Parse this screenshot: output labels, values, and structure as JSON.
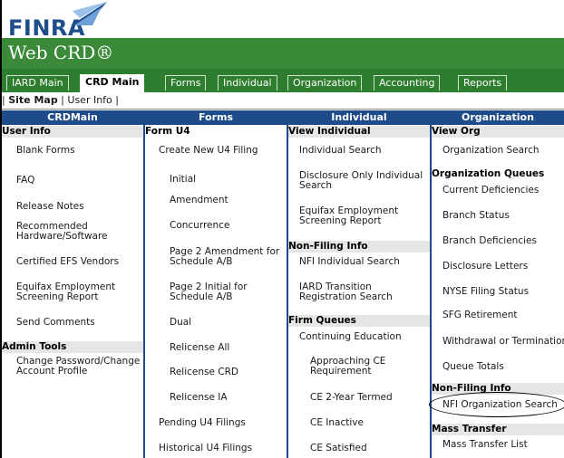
{
  "header": {
    "logo_text": "FINRA",
    "app_title": "Web CRD®"
  },
  "tabs": [
    {
      "label": "IARD Main"
    },
    {
      "label": "CRD Main"
    },
    {
      "label": "Forms"
    },
    {
      "label": "Individual"
    },
    {
      "label": "Organization"
    },
    {
      "label": "Accounting"
    },
    {
      "label": "Reports"
    }
  ],
  "sitemap": {
    "pipe1": "| ",
    "site_map": "Site Map",
    "pipe2": " | ",
    "user_info": "User Info",
    "pipe3": " |"
  },
  "columns": {
    "crdmain": {
      "title": "CRDMain",
      "user_info": "User Info",
      "blank_forms": "Blank Forms",
      "faq": "FAQ",
      "release_notes": "Release Notes",
      "recommended_1": "Recommended",
      "recommended_2": "Hardware/Software",
      "efs_vendors": "Certified EFS Vendors",
      "equifax_1": "Equifax Employment",
      "equifax_2": "Screening Report",
      "send_comments": "Send Comments",
      "admin_tools": "Admin Tools",
      "change_pw_1": "Change Password/Change",
      "change_pw_2": "Account Profile"
    },
    "forms": {
      "title": "Forms",
      "form_u4": "Form U4",
      "create_new": "Create New U4 Filing",
      "initial": "Initial",
      "amendment": "Amendment",
      "concurrence": "Concurrence",
      "p2_amend_1": "Page 2 Amendment for",
      "p2_amend_2": "Schedule A/B",
      "p2_init_1": "Page 2 Initial for",
      "p2_init_2": "Schedule A/B",
      "dual": "Dual",
      "relicense_all": "Relicense All",
      "relicense_crd": "Relicense CRD",
      "relicense_ia": "Relicense IA",
      "pending": "Pending U4 Filings",
      "historical": "Historical U4 Filings"
    },
    "individual": {
      "title": "Individual",
      "view_individual": "View Individual",
      "ind_search": "Individual Search",
      "disc_only_1": "Disclosure Only Individual",
      "disc_only_2": "Search",
      "equifax_1": "Equifax Employment",
      "equifax_2": "Screening Report",
      "non_filing": "Non-Filing Info",
      "nfi_ind": "NFI Individual Search",
      "iard_1": "IARD Transition",
      "iard_2": "Registration Search",
      "firm_queues": "Firm Queues",
      "cont_ed": "Continuing Education",
      "approach_1": "Approaching CE",
      "approach_2": "Requirement",
      "ce_2yr": "CE 2-Year Termed",
      "ce_inactive": "CE Inactive",
      "ce_satisfied": "CE Satisfied"
    },
    "organization": {
      "title": "Organization",
      "view_org": "View Org",
      "org_search": "Organization Search",
      "org_queues": "Organization Queues",
      "curr_def": "Current Deficiencies",
      "branch_status": "Branch Status",
      "branch_def": "Branch Deficiencies",
      "disc_letters": "Disclosure Letters",
      "nyse": "NYSE Filing Status",
      "sfg": "SFG Retirement",
      "withdrawal": "Withdrawal or Termination",
      "queue_totals": "Queue Totals",
      "non_filing": "Non-Filing Info",
      "nfi_org": "NFI Organization Search",
      "mass_transfer": "Mass Transfer",
      "mass_list": "Mass Transfer List"
    }
  }
}
